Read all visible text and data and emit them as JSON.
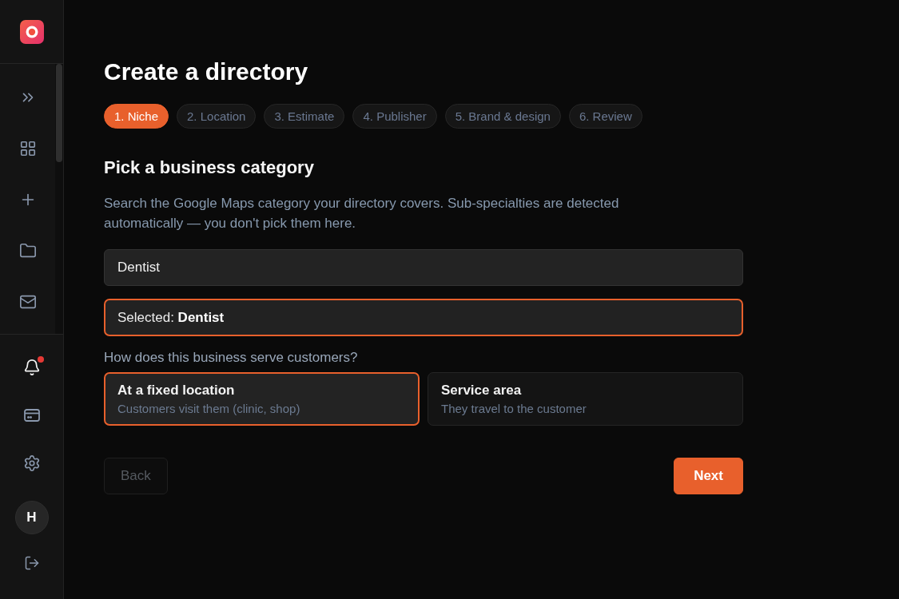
{
  "sidebar": {
    "notifications": {
      "unread": true
    },
    "avatar": {
      "initial": "H"
    }
  },
  "page": {
    "title": "Create a directory"
  },
  "steps": [
    {
      "label": "1. Niche",
      "selected": true
    },
    {
      "label": "2. Location",
      "selected": false
    },
    {
      "label": "3. Estimate",
      "selected": false
    },
    {
      "label": "4. Publisher",
      "selected": false
    },
    {
      "label": "5. Brand & design",
      "selected": false
    },
    {
      "label": "6. Review",
      "selected": false
    }
  ],
  "section": {
    "title": "Pick a business category",
    "description": "Search the Google Maps category your directory covers. Sub-specialties are detected automatically — you don't pick them here."
  },
  "category_search": {
    "value": "Dentist"
  },
  "selection": {
    "text": "Selected: **Dentist**"
  },
  "service_question": "How does this business serve customers?",
  "service_options": [
    {
      "title": "At a fixed location",
      "subtitle": "Customers visit them (clinic, shop)",
      "selected": true
    },
    {
      "title": "Service area",
      "subtitle": "They travel to the customer",
      "selected": false
    }
  ],
  "buttons": {
    "back": {
      "label": "Back",
      "disabled": true
    },
    "next": {
      "label": "Next",
      "disabled": false
    }
  }
}
